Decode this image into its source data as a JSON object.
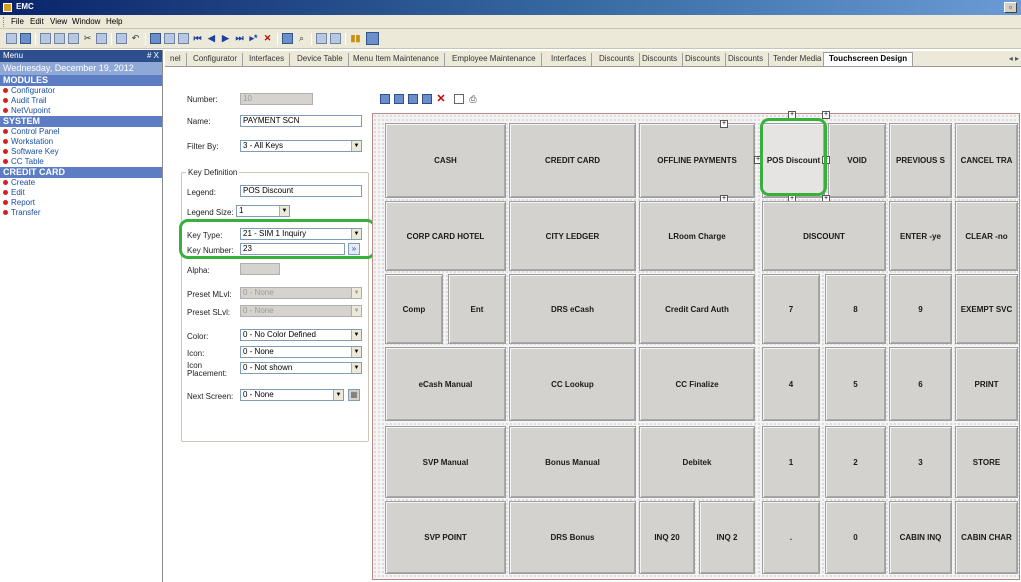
{
  "window": {
    "title": "EMC",
    "restore_label": "▫"
  },
  "menubar": [
    "File",
    "Edit",
    "View",
    "Window",
    "Help"
  ],
  "menu_panel": {
    "title": "Menu",
    "pin_label": "# X",
    "date": "Wednesday, December 19, 2012",
    "sections": [
      {
        "label": "MODULES",
        "items": [
          "Configurator",
          "Audit Trail",
          "NetVupoint"
        ]
      },
      {
        "label": "SYSTEM",
        "items": [
          "Control Panel",
          "Workstation",
          "Software Key",
          "CC Table"
        ]
      },
      {
        "label": "CREDIT CARD",
        "items": [
          "Create",
          "Edit",
          "Report",
          "Transfer"
        ]
      }
    ]
  },
  "tabs": [
    "nel",
    "Configurator",
    "Interfaces",
    "Device Table",
    "Menu Item Maintenance",
    "Employee Maintenance",
    "Interfaces",
    "Discounts",
    "Discounts",
    "Discounts",
    "Discounts",
    "Tender Media",
    "Touchscreen Design"
  ],
  "tab_nav": "◂ ▸",
  "props": {
    "number_label": "Number:",
    "number_value": "10",
    "name_label": "Name:",
    "name_value": "PAYMENT SCN",
    "filter_label": "Filter By:",
    "filter_value": "3 - All Keys",
    "key_definition_title": "Key Definition",
    "legend_label": "Legend:",
    "legend_value": "POS Discount",
    "legend_size_label": "Legend Size:",
    "legend_size_value": "1",
    "key_type_label": "Key Type:",
    "key_type_value": "21 - SIM 1 Inquiry",
    "key_number_label": "Key Number:",
    "key_number_value": "23",
    "alpha_label": "Alpha:",
    "preset_mlvl_label": "Preset MLvl:",
    "preset_mlvl_value": "0 - None",
    "preset_slvl_label": "Preset SLvl:",
    "preset_slvl_value": "0 - None",
    "color_label": "Color:",
    "color_value": "0 - No Color Defined",
    "icon_label": "Icon:",
    "icon_value": "0 - None",
    "icon_placement_label_1": "Icon",
    "icon_placement_label_2": "Placement:",
    "icon_placement_value": "0 - Not shown",
    "next_screen_label": "Next Screen:",
    "next_screen_value": "0 - None",
    "browse_glyph": "»"
  },
  "keys": [
    [
      "CASH",
      "CREDIT CARD",
      "OFFLINE PAYMENTS",
      "POS Discount",
      "VOID",
      "PREVIOUS S",
      "CANCEL TRA"
    ],
    [
      "CORP CARD HOTEL",
      "CITY LEDGER",
      "LRoom Charge",
      "DISCOUNT",
      "ENTER -ye",
      "CLEAR -no"
    ],
    [
      "Comp",
      "Ent",
      "DRS eCash",
      "Credit Card Auth",
      "7",
      "8",
      "9",
      "EXEMPT SVC"
    ],
    [
      "eCash Manual",
      "CC Lookup",
      "CC Finalize",
      "4",
      "5",
      "6",
      "PRINT"
    ],
    [
      "SVP Manual",
      "Bonus Manual",
      "Debitek",
      "1",
      "2",
      "3",
      "STORE"
    ],
    [
      "SVP POINT",
      "DRS Bonus",
      "INQ 20",
      "INQ 2",
      ".",
      "0",
      "CABIN INQ",
      "CABIN CHAR"
    ]
  ],
  "colors": {
    "highlight": "#38b13c",
    "menu_header": "#2e4f8e",
    "section_header": "#5c7cc4",
    "bullet": "#d62020"
  }
}
